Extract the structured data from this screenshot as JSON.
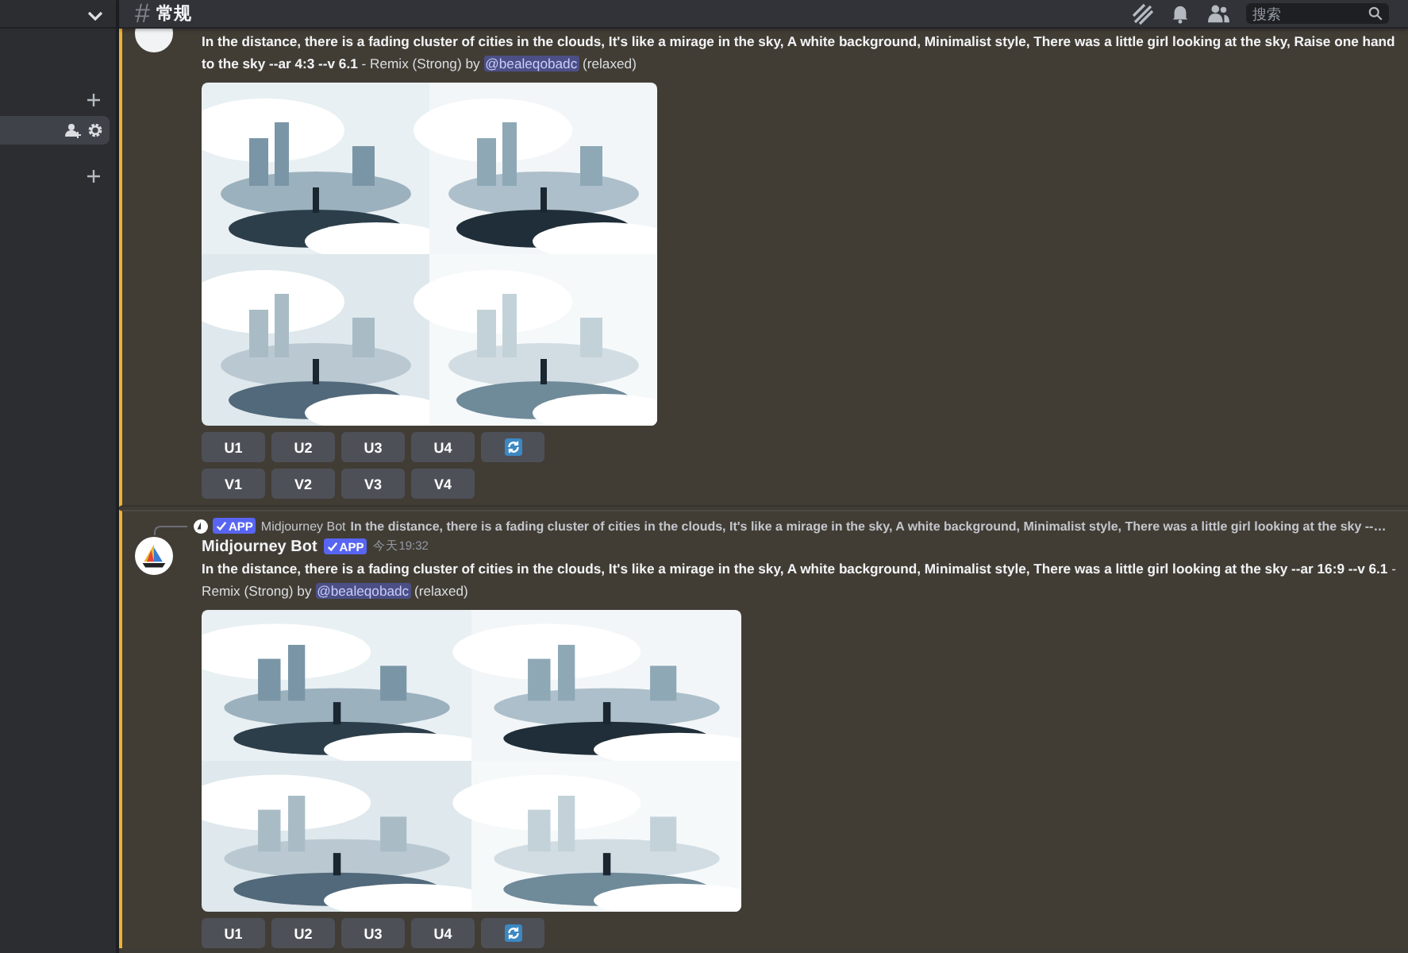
{
  "sidebar": {
    "rows": [
      {
        "kind": "category"
      },
      {
        "kind": "channel",
        "selected": true
      },
      {
        "kind": "category"
      }
    ]
  },
  "header": {
    "channel_icon": "#",
    "channel": "常规",
    "search": {
      "placeholder": "搜索"
    }
  },
  "messages": [
    {
      "highlighted": true,
      "text": "**In the distance, there is a fading cluster of cities in the clouds, It's like a mirage in the sky, A white background, Minimalist style, There was a little girl looking at the sky, Raise one hand to the sky --ar 4:3 --v 6.1** - Remix (Strong) by",
      "mention": "@bealeqobadc",
      "status": "(relaxed)",
      "kind": "square",
      "button_rows": [
        [
          {
            "kind": "text",
            "label": "U1"
          },
          {
            "kind": "text",
            "label": "U2"
          },
          {
            "kind": "text",
            "label": "U3"
          },
          {
            "kind": "text",
            "label": "U4"
          },
          {
            "kind": "refresh"
          }
        ],
        [
          {
            "kind": "text",
            "label": "V1"
          },
          {
            "kind": "text",
            "label": "V2"
          },
          {
            "kind": "text",
            "label": "V3"
          },
          {
            "kind": "text",
            "label": "V4"
          }
        ]
      ]
    },
    {
      "highlighted": true,
      "reply": {
        "badge": "APP",
        "author": "Midjourney Bot",
        "text": "In the distance, there is a fading cluster of cities in the clouds, It's like a mirage in the sky, A white background, Minimalist style, There was a little girl looking at the sky --…"
      },
      "author": {
        "name": "Midjourney Bot",
        "badge": "APP",
        "time": "今天19:32"
      },
      "text": "**In the distance, there is a fading cluster of cities in the clouds, It's like a mirage in the sky, A white background, Minimalist style, There was a little girl looking at the sky --ar 16:9 --v 6.1** - Remix (Strong) by",
      "mention": "@bealeqobadc",
      "status": "(relaxed)",
      "kind": "wide",
      "button_rows": [
        [
          {
            "kind": "text",
            "label": "U1"
          },
          {
            "kind": "text",
            "label": "U2"
          },
          {
            "kind": "text",
            "label": "U3"
          },
          {
            "kind": "text",
            "label": "U4"
          },
          {
            "kind": "refresh"
          }
        ]
      ]
    }
  ]
}
